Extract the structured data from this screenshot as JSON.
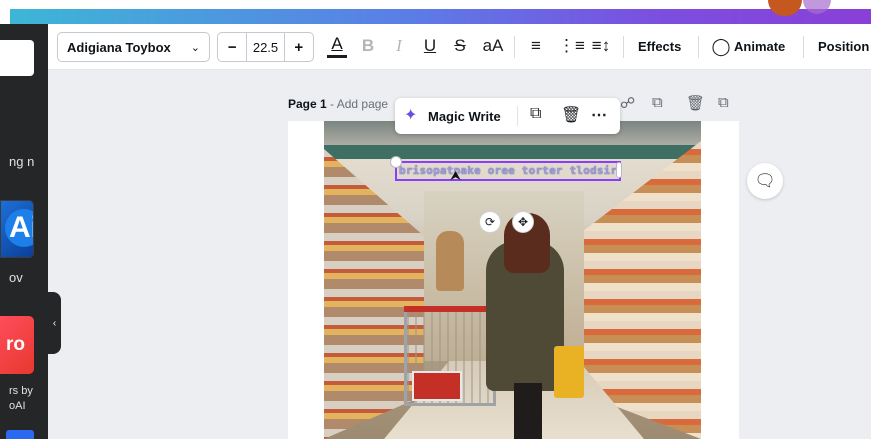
{
  "left_panel": {
    "items": [
      {
        "label": "ng n"
      },
      {
        "label": "ov"
      },
      {
        "label": "rs by"
      },
      {
        "label": "oAI"
      }
    ],
    "apps": [
      {
        "label": "Ai"
      },
      {
        "label": "ro"
      }
    ],
    "collapse_icon": "chevron-left-icon"
  },
  "toolbar": {
    "font_name": "Adigiana Toybox",
    "font_size": "22.5",
    "decrease_label": "−",
    "increase_label": "+",
    "text_color_label": "A",
    "bold_label": "B",
    "italic_label": "I",
    "underline_label": "U",
    "strike_label": "S",
    "case_label": "aA",
    "effects_label": "Effects",
    "animate_label": "Animate",
    "position_label": "Position",
    "accent_color": "#8b3dff"
  },
  "page": {
    "title": "Page 1",
    "title_sep": " - ",
    "add_title_placeholder": "Add page"
  },
  "text_element": {
    "content": "brisopatpake oree torter tlodsire"
  },
  "floating_toolbar": {
    "magic_write_label": "Magic Write"
  }
}
